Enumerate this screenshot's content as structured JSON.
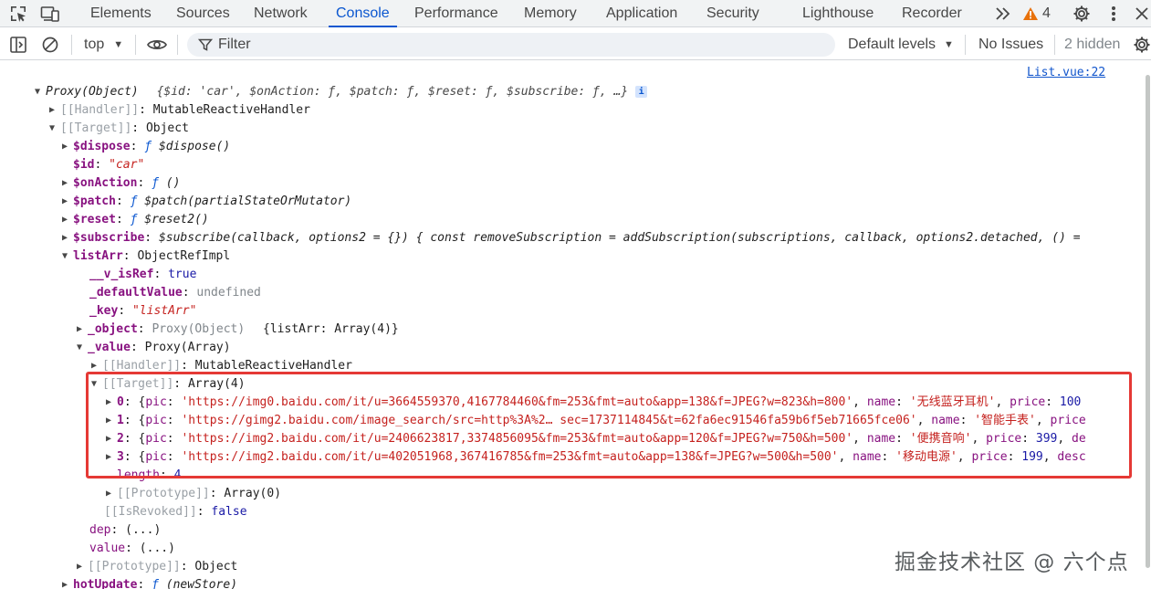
{
  "tabs": [
    {
      "label": "Elements",
      "active": false
    },
    {
      "label": "Sources",
      "active": false
    },
    {
      "label": "Network",
      "active": false
    },
    {
      "label": "Console",
      "active": true
    },
    {
      "label": "Performance",
      "active": false
    },
    {
      "label": "Memory",
      "active": false
    },
    {
      "label": "Application",
      "active": false
    },
    {
      "label": "Security",
      "active": false
    },
    {
      "label": "Lighthouse",
      "active": false
    },
    {
      "label": "Recorder",
      "active": false
    }
  ],
  "tabbar_icons": [
    "inspect-element-icon",
    "device-toolbar-icon",
    "more-tabs-icon",
    "warning-icon",
    "settings-gear-icon",
    "kebab-menu-icon",
    "close-icon"
  ],
  "warning_count": "4",
  "toolbar": {
    "context": "top",
    "filter_placeholder": "Filter",
    "levels": "Default levels",
    "issues": "No Issues",
    "hidden": "2 hidden"
  },
  "source_link": "List.vue:22",
  "lines": {
    "l0_head": "Proxy(Object)",
    "l0_preview": "{$id: 'car', $onAction: ƒ, $patch: ƒ, $reset: ƒ, $subscribe: ƒ, …}",
    "l1_key": "[[Handler]]",
    "l1_val": "MutableReactiveHandler",
    "l2_key": "[[Target]]",
    "l2_val": "Object",
    "l3_key": "$dispose",
    "l3_val": "$dispose()",
    "l4_key": "$id",
    "l4_val": "\"car\"",
    "l5_key": "$onAction",
    "l5_val": "()",
    "l6_key": "$patch",
    "l6_val": "$patch(partialStateOrMutator)",
    "l7_key": "$reset",
    "l7_val": "$reset2()",
    "l8_key": "$subscribe",
    "l8_val": "$subscribe(callback, options2 = {}) { const removeSubscription = addSubscription(subscriptions, callback, options2.detached, () =",
    "l9_key": "listArr",
    "l9_val": "ObjectRefImpl",
    "l10_key": "__v_isRef",
    "l10_val": "true",
    "l11_key": "_defaultValue",
    "l11_val": "undefined",
    "l12_key": "_key",
    "l12_val": "\"listArr\"",
    "l13_key": "_object",
    "l13_val": "Proxy(Object)",
    "l13_preview": "{listArr: Array(4)}",
    "l14_key": "_value",
    "l14_val": "Proxy(Array)",
    "l15_key": "[[Handler]]",
    "l15_val": "MutableReactiveHandler",
    "l16_key": "[[Target]]",
    "l16_val": "Array(4)",
    "items": [
      {
        "idx": "0",
        "pic": "'https://img0.baidu.com/it/u=3664559370,4167784460&fm=253&fmt=auto&app=138&f=JPEG?w=823&h=800'",
        "name": "'无线蓝牙耳机'",
        "price": "100",
        "tail": ""
      },
      {
        "idx": "1",
        "pic": "'https://gimg2.baidu.com/image_search/src=http%3A%2… sec=1737114845&t=62fa6ec91546fa59b6f5eb71665fce06'",
        "name": "'智能手表'",
        "price": "",
        "tail": ""
      },
      {
        "idx": "2",
        "pic": "'https://img2.baidu.com/it/u=2406623817,3374856095&fm=253&fmt=auto&app=120&f=JPEG?w=750&h=500'",
        "name": "'便携音响'",
        "price": "399",
        "tail": "de"
      },
      {
        "idx": "3",
        "pic": "'https://img2.baidu.com/it/u=402051968,367416785&fm=253&fmt=auto&app=138&f=JPEG?w=500&h=500'",
        "name": "'移动电源'",
        "price": "199",
        "tail": "desc"
      }
    ],
    "length_key": "length",
    "length_val": "4",
    "l22_key": "[[Prototype]]",
    "l22_val": "Array(0)",
    "l23_key": "[[IsRevoked]]",
    "l23_val": "false",
    "l24_key": "dep",
    "l24_val": "(...)",
    "l25_key": "value",
    "l25_val": "(...)",
    "l26_key": "[[Prototype]]",
    "l26_val": "Object",
    "l27_key": "hotUpdate",
    "l27_val": "(newStore)"
  },
  "watermark": "掘金技术社区 @ 六个点"
}
